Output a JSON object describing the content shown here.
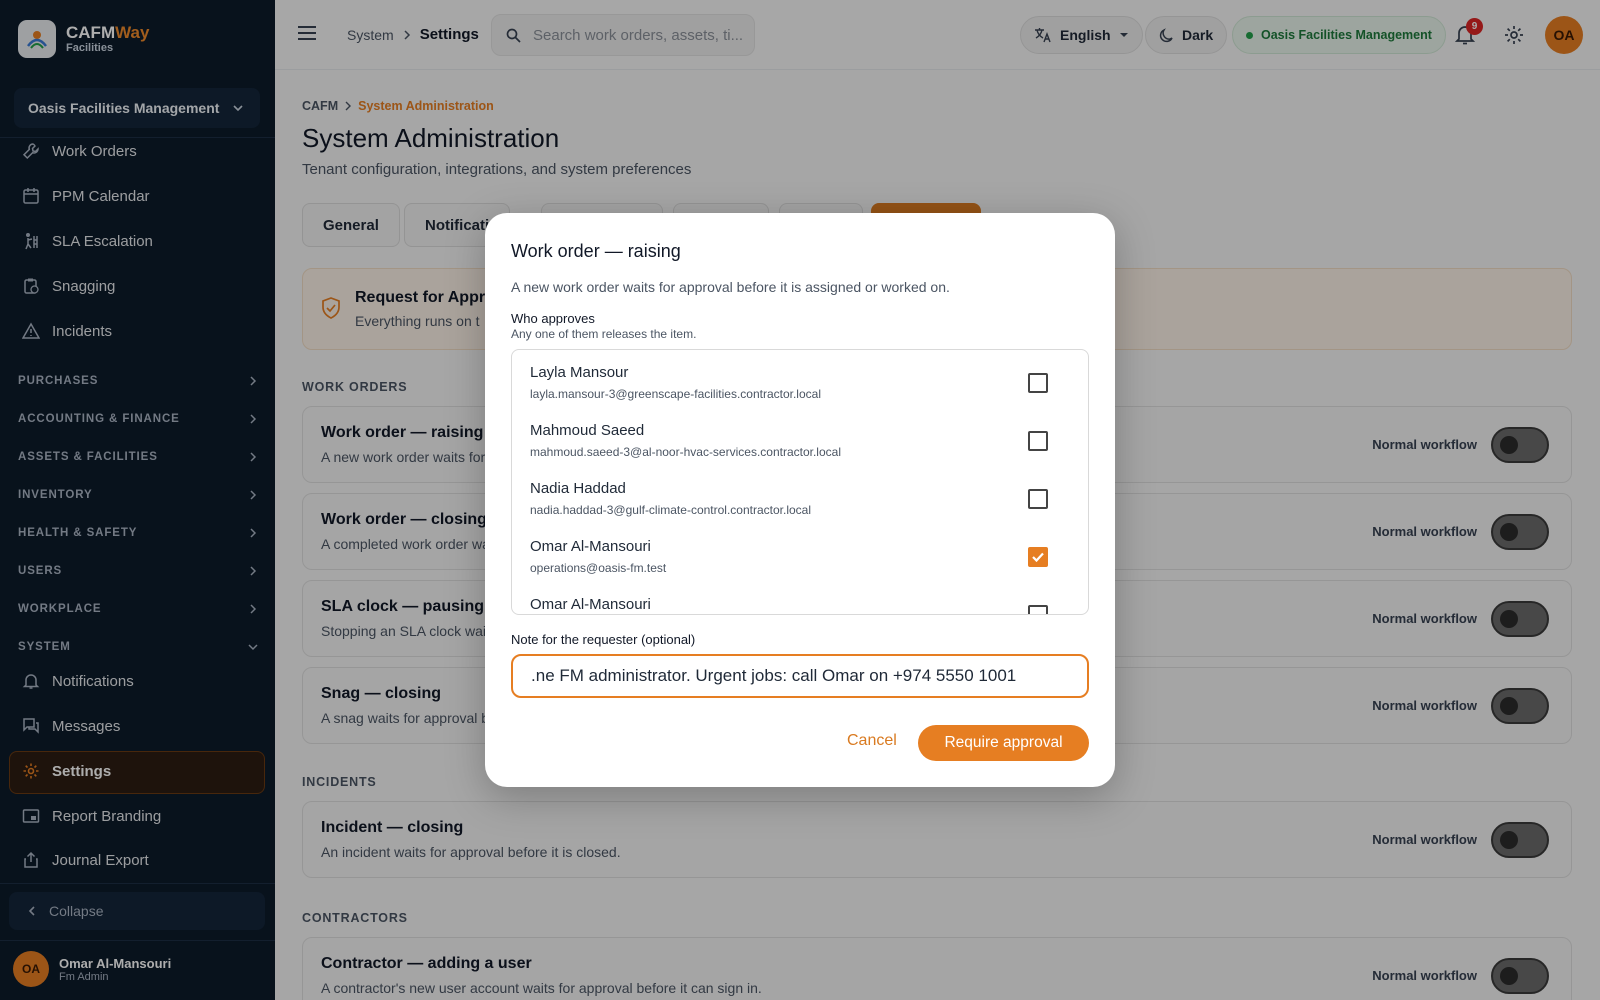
{
  "brand": {
    "name_a": "CAFM",
    "name_b": "Way",
    "sub": "Facilities"
  },
  "sidebar": {
    "org": "Oasis Facilities Management",
    "items_top": [
      {
        "label": "Work Orders"
      },
      {
        "label": "PPM Calendar"
      },
      {
        "label": "SLA Escalation"
      },
      {
        "label": "Snagging"
      },
      {
        "label": "Incidents"
      }
    ],
    "groups": [
      {
        "label": "PURCHASES"
      },
      {
        "label": "ACCOUNTING & FINANCE"
      },
      {
        "label": "ASSETS & FACILITIES"
      },
      {
        "label": "INVENTORY"
      },
      {
        "label": "HEALTH & SAFETY"
      },
      {
        "label": "USERS"
      },
      {
        "label": "WORKPLACE"
      },
      {
        "label": "SYSTEM"
      }
    ],
    "items_system": [
      {
        "label": "Notifications"
      },
      {
        "label": "Messages"
      },
      {
        "label": "Settings"
      },
      {
        "label": "Report Branding"
      },
      {
        "label": "Journal Export"
      }
    ],
    "collapse": "Collapse",
    "user": {
      "initials": "OA",
      "name": "Omar Al-Mansouri",
      "role": "Fm Admin"
    }
  },
  "topbar": {
    "crumb": [
      "System",
      "Settings"
    ],
    "search_placeholder": "Search work orders, assets, ti...",
    "language": "English",
    "theme": "Dark",
    "org": "Oasis Facilities Management",
    "notifications": "9",
    "initials": "OA"
  },
  "page": {
    "breadcrumb": [
      "CAFM",
      "System Administration"
    ],
    "title": "System Administration",
    "subtitle": "Tenant configuration, integrations, and system preferences",
    "tabs": [
      {
        "label": "General"
      },
      {
        "label": "Notificati"
      }
    ],
    "banner": {
      "title": "Request for Appro",
      "desc": "Everything runs on t"
    },
    "sections": {
      "wo": "WORK ORDERS",
      "inc": "INCIDENTS",
      "con": "CONTRACTORS"
    },
    "workflow_label": "Normal workflow",
    "cards": [
      {
        "title": "Work order — raising",
        "desc": "A new work order waits for"
      },
      {
        "title": "Work order — closing",
        "desc": "A completed work order wa"
      },
      {
        "title": "SLA clock — pausing",
        "desc": "Stopping an SLA clock wai"
      },
      {
        "title": "Snag — closing",
        "desc": "A snag waits for approval b"
      },
      {
        "title": "Incident — closing",
        "desc": "An incident waits for approval before it is closed."
      },
      {
        "title": "Contractor — adding a user",
        "desc": "A contractor's new user account waits for approval before it can sign in."
      }
    ]
  },
  "dialog": {
    "title": "Work order — raising",
    "desc": "A new work order waits for approval before it is assigned or worked on.",
    "approvers_label": "Who approves",
    "approvers_help": "Any one of them releases the item.",
    "approvers": [
      {
        "name": "Layla Mansour",
        "email": "layla.mansour-3@greenscape-facilities.contractor.local",
        "checked": false
      },
      {
        "name": "Mahmoud Saeed",
        "email": "mahmoud.saeed-3@al-noor-hvac-services.contractor.local",
        "checked": false
      },
      {
        "name": "Nadia Haddad",
        "email": "nadia.haddad-3@gulf-climate-control.contractor.local",
        "checked": false
      },
      {
        "name": "Omar Al-Mansouri",
        "email": "operations@oasis-fm.test",
        "checked": true
      },
      {
        "name": "Omar Al-Mansouri",
        "email": "",
        "checked": false
      }
    ],
    "note_label": "Note for the requester (optional)",
    "note_value": "ne FM administrator. Urgent jobs: call Omar on +974 5550 1001.",
    "cancel": "Cancel",
    "submit": "Require approval"
  },
  "colors": {
    "accent": "#e67e22",
    "sidebar": "#0d1b2a",
    "success": "#22a04b"
  }
}
